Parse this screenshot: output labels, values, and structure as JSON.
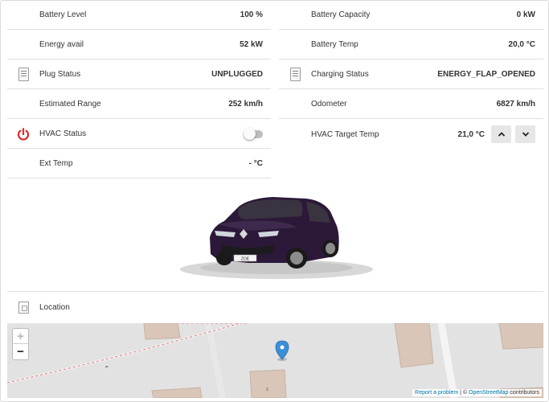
{
  "left_rows": [
    {
      "label": "Battery Level",
      "value": "100 %"
    },
    {
      "label": "Energy avail",
      "value": "52 kW"
    },
    {
      "label": "Plug Status",
      "value": "UNPLUGGED"
    },
    {
      "label": "Estimated Range",
      "value": "252 km/h"
    },
    {
      "label": "HVAC Status",
      "value": ""
    },
    {
      "label": "Ext Temp",
      "value": "- °C"
    }
  ],
  "right_rows": [
    {
      "label": "Battery Capacity",
      "value": "0 kW"
    },
    {
      "label": "Battery Temp",
      "value": "20,0 °C"
    },
    {
      "label": "Charging Status",
      "value": "ENERGY_FLAP_OPENED"
    },
    {
      "label": "Odometer",
      "value": "6827 km/h"
    },
    {
      "label": "HVAC Target Temp",
      "value": "21,0 °C"
    }
  ],
  "hvac_toggle": {
    "on": false
  },
  "car": {
    "plate_text": "ZOE",
    "color": "#2c1838"
  },
  "location": {
    "label": "Location"
  },
  "map": {
    "zoom_in": "+",
    "zoom_out": "−",
    "house_number": "3",
    "attrib_report": "Report a problem",
    "attrib_sep": " | © ",
    "attrib_osm": "OpenStreetMap",
    "attrib_suffix": " contributors",
    "marker_color": "#3a8fd6"
  },
  "icons": {
    "doc": "document-icon",
    "power": "power-icon",
    "up": "chevron-up-icon",
    "down": "chevron-down-icon",
    "map_doc": "map-document-icon"
  },
  "colors": {
    "power": "#d32f2f",
    "divider": "#e0e0e0"
  }
}
